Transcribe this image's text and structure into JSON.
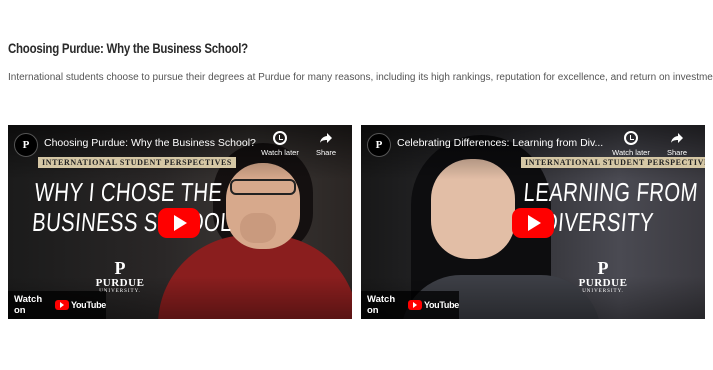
{
  "section": {
    "title": "Choosing Purdue: Why the Business School?",
    "intro": "International students choose to pursue their degrees at Purdue for many reasons, including its high rankings, reputation for excellence, and return on investment."
  },
  "videos": [
    {
      "title": "Choosing Purdue: Why the Business School?",
      "tag": "INTERNATIONAL STUDENT PERSPECTIVES",
      "headline_line1": "WHY I CHOSE THE",
      "headline_line2": "BUSINESS SCHOOL",
      "brand_mark": "P",
      "brand_word": "PURDUE",
      "brand_sub": "UNIVERSITY.",
      "watch_later": "Watch later",
      "share": "Share",
      "watch_on": "Watch on",
      "youtube": "YouTube"
    },
    {
      "title": "Celebrating Differences: Learning from Div...",
      "tag": "INTERNATIONAL STUDENT PERSPECTIVES",
      "headline_line1": "LEARNING FROM",
      "headline_line2": "DIVERSITY",
      "brand_mark": "P",
      "brand_word": "PURDUE",
      "brand_sub": "UNIVERSITY.",
      "watch_later": "Watch later",
      "share": "Share",
      "watch_on": "Watch on",
      "youtube": "YouTube"
    }
  ],
  "icons": {
    "channel": "purdue-channel-icon",
    "watch_later": "clock-icon",
    "share": "share-arrow-icon",
    "play": "youtube-play-icon"
  },
  "colors": {
    "youtube_red": "#ff0000",
    "tag_bg": "#d5c7a5"
  }
}
